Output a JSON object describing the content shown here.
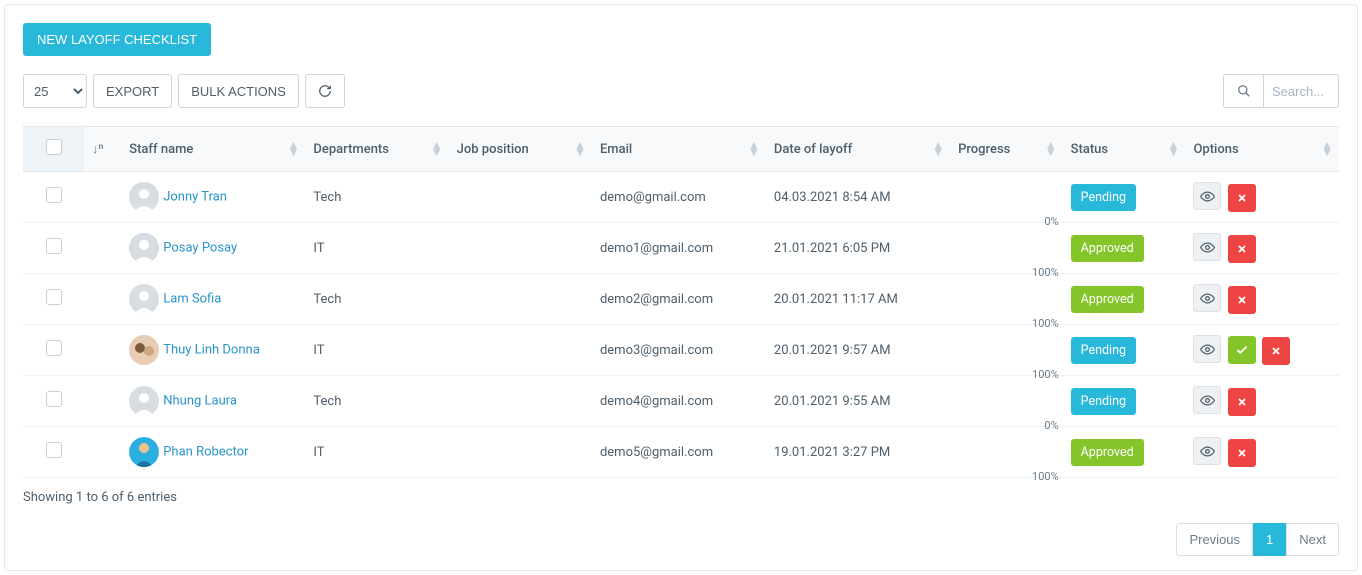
{
  "colors": {
    "primary": "#28b8da",
    "approved": "#84c529",
    "pending": "#28b8da",
    "danger": "#ef4444"
  },
  "header": {
    "new_button": "NEW LAYOFF CHECKLIST"
  },
  "toolbar": {
    "page_size": "25",
    "export": "EXPORT",
    "bulk_actions": "BULK ACTIONS",
    "search_placeholder": "Search..."
  },
  "columns": {
    "staff": "Staff name",
    "departments": "Departments",
    "job": "Job position",
    "email": "Email",
    "date": "Date of layoff",
    "progress": "Progress",
    "status": "Status",
    "options": "Options"
  },
  "rows": [
    {
      "name": "Jonny Tran",
      "dept": "Tech",
      "job": "",
      "email": "demo@gmail.com",
      "date": "04.03.2021 8:54 AM",
      "progress": "0%",
      "status": "Pending",
      "status_color": "#28b8da",
      "show_approve": false,
      "avatar_bg": "#d7dde3",
      "avatar_icon": "person"
    },
    {
      "name": "Posay Posay",
      "dept": "IT",
      "job": "",
      "email": "demo1@gmail.com",
      "date": "21.01.2021 6:05 PM",
      "progress": "100%",
      "status": "Approved",
      "status_color": "#84c529",
      "show_approve": false,
      "avatar_bg": "#d7dde3",
      "avatar_icon": "person"
    },
    {
      "name": "Lam Sofia",
      "dept": "Tech",
      "job": "",
      "email": "demo2@gmail.com",
      "date": "20.01.2021 11:17 AM",
      "progress": "100%",
      "status": "Approved",
      "status_color": "#84c529",
      "show_approve": false,
      "avatar_bg": "#d7dde3",
      "avatar_icon": "person"
    },
    {
      "name": "Thuy Linh Donna",
      "dept": "IT",
      "job": "",
      "email": "demo3@gmail.com",
      "date": "20.01.2021 9:57 AM",
      "progress": "100%",
      "status": "Pending",
      "status_color": "#28b8da",
      "show_approve": true,
      "avatar_bg": "#f0d9c0",
      "avatar_icon": "photo"
    },
    {
      "name": "Nhung Laura",
      "dept": "Tech",
      "job": "",
      "email": "demo4@gmail.com",
      "date": "20.01.2021 9:55 AM",
      "progress": "0%",
      "status": "Pending",
      "status_color": "#28b8da",
      "show_approve": false,
      "avatar_bg": "#d7dde3",
      "avatar_icon": "person"
    },
    {
      "name": "Phan Robector",
      "dept": "IT",
      "job": "",
      "email": "demo5@gmail.com",
      "date": "19.01.2021 3:27 PM",
      "progress": "100%",
      "status": "Approved",
      "status_color": "#84c529",
      "show_approve": false,
      "avatar_bg": "#27b6e0",
      "avatar_icon": "photo2"
    }
  ],
  "footer": {
    "info": "Showing 1 to 6 of 6 entries",
    "prev": "Previous",
    "page": "1",
    "next": "Next"
  }
}
